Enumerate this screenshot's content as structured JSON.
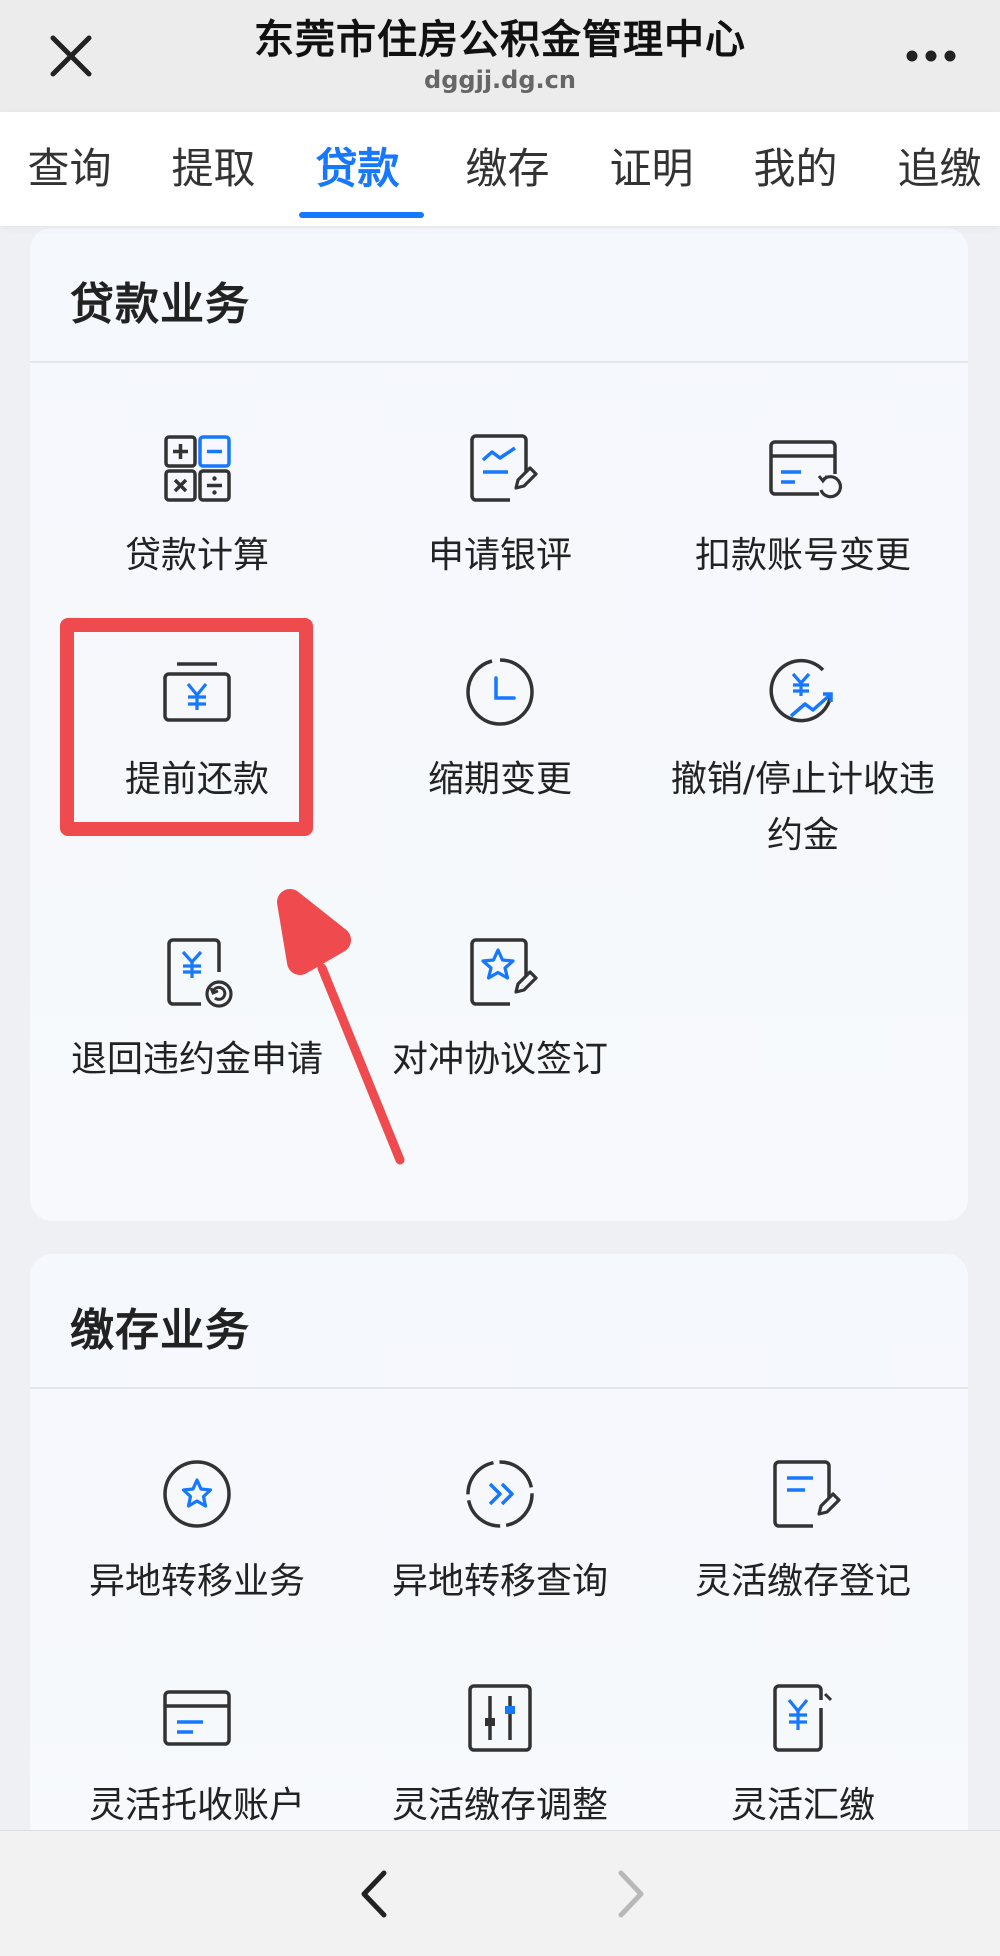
{
  "header": {
    "title": "东莞市住房公积金管理中心",
    "subtitle": "dggjj.dg.cn"
  },
  "tabs": [
    {
      "label": "查询"
    },
    {
      "label": "提取"
    },
    {
      "label": "贷款",
      "active": true
    },
    {
      "label": "缴存"
    },
    {
      "label": "证明"
    },
    {
      "label": "我的"
    },
    {
      "label": "追缴"
    }
  ],
  "loan_section": {
    "title": "贷款业务",
    "items": [
      {
        "label": "贷款计算",
        "icon": "calculator-icon"
      },
      {
        "label": "申请银评",
        "icon": "document-edit-icon"
      },
      {
        "label": "扣款账号变更",
        "icon": "card-refresh-icon"
      },
      {
        "label": "提前还款",
        "icon": "yuan-box-icon"
      },
      {
        "label": "缩期变更",
        "icon": "clock-icon"
      },
      {
        "label": "撤销/停止计收违约金",
        "icon": "yuan-trend-icon"
      },
      {
        "label": "退回违约金申请",
        "icon": "yuan-document-return-icon"
      },
      {
        "label": "对冲协议签订",
        "icon": "star-document-icon"
      }
    ]
  },
  "deposit_section": {
    "title": "缴存业务",
    "items": [
      {
        "label": "异地转移业务",
        "icon": "star-circle-icon"
      },
      {
        "label": "异地转移查询",
        "icon": "forward-circle-icon"
      },
      {
        "label": "灵活缴存登记",
        "icon": "document-pen-icon"
      },
      {
        "label": "灵活托收账户",
        "icon": "card-icon"
      },
      {
        "label": "灵活缴存调整",
        "icon": "sliders-icon"
      },
      {
        "label": "灵活汇缴",
        "icon": "yuan-document-icon"
      }
    ]
  },
  "colors": {
    "accent": "#1677ff",
    "annotation": "#ef4b4f",
    "icon_stroke": "#333333"
  }
}
